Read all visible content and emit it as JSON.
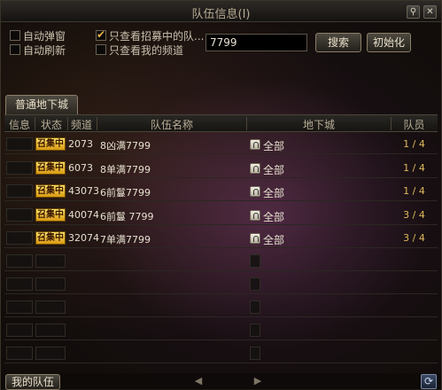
{
  "window": {
    "title": "队伍信息(I)",
    "pin_icon": "pin-icon",
    "close_icon": "close-icon"
  },
  "options": {
    "auto_popup": "自动弹窗",
    "auto_refresh": "自动刷新",
    "only_recruiting": "只查看招募中的队...",
    "only_my_channel": "只查看我的频道",
    "only_recruiting_checked": true
  },
  "search": {
    "value": "7799",
    "search_label": "搜索",
    "reset_label": "初始化"
  },
  "tab": {
    "label": "普通地下城"
  },
  "table": {
    "headers": {
      "info": "信息",
      "status": "状态",
      "channel": "频道",
      "team_name": "队伍名称",
      "dungeon": "地下城",
      "members": "队员"
    },
    "rows": [
      {
        "status": "召集中",
        "channel": "2073",
        "name": "8凶满7799",
        "dungeon": "全部",
        "members": "1 / 4"
      },
      {
        "status": "召集中",
        "channel": "6073",
        "name": "8单满7799",
        "dungeon": "全部",
        "members": "1 / 4"
      },
      {
        "status": "召集中",
        "channel": "43073",
        "name": "6前鬘7799",
        "dungeon": "全部",
        "members": "1 / 4"
      },
      {
        "status": "召集中",
        "channel": "40074",
        "name": "6前鬘  7799",
        "dungeon": "全部",
        "members": "3 / 4"
      },
      {
        "status": "召集中",
        "channel": "32074",
        "name": "7单满7799",
        "dungeon": "全部",
        "members": "3 / 4"
      }
    ]
  },
  "footer": {
    "my_team_label": "我的队伍",
    "prev_icon": "prev-page-icon",
    "next_icon": "next-page-icon",
    "refresh_icon": "refresh-icon"
  },
  "colors": {
    "badge": "#f3c335",
    "members_text": "#e0b85a"
  }
}
